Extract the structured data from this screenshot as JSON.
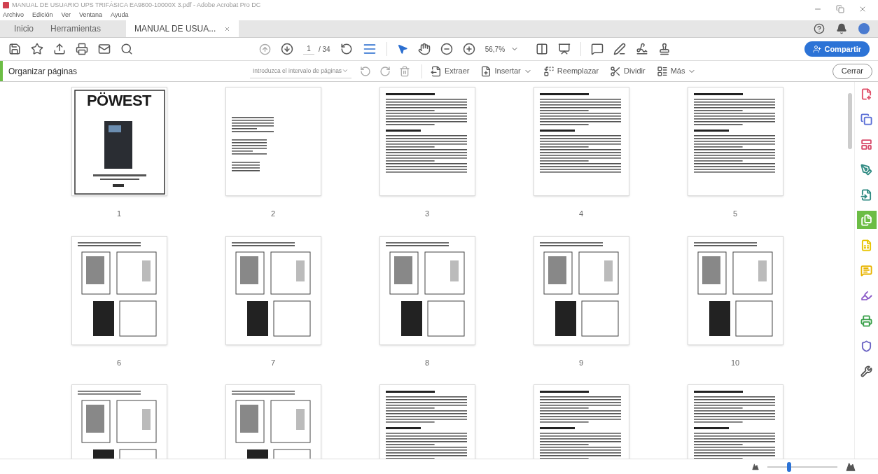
{
  "window": {
    "title": "MANUAL DE USUARIO UPS TRIFÁSICA EA9800-10000X 3.pdf - Adobe Acrobat Pro DC"
  },
  "menu": [
    "Archivo",
    "Edición",
    "Ver",
    "Ventana",
    "Ayuda"
  ],
  "tabs": [
    {
      "label": "Inicio",
      "selected": false,
      "closable": false
    },
    {
      "label": "Herramientas",
      "selected": false,
      "closable": false
    },
    {
      "label": "MANUAL DE USUA...",
      "selected": true,
      "closable": true
    }
  ],
  "toolbar": {
    "page_current": "1",
    "page_total": "/ 34",
    "zoom": "56,7%",
    "share_button": "Compartir"
  },
  "organize_bar": {
    "title": "Organizar páginas",
    "range_placeholder": "Introduzca el intervalo de páginas",
    "actions": [
      {
        "label": "Extraer",
        "dropdown": false
      },
      {
        "label": "Insertar",
        "dropdown": true
      },
      {
        "label": "Reemplazar",
        "dropdown": false
      },
      {
        "label": "Dividir",
        "dropdown": false
      },
      {
        "label": "Más",
        "dropdown": true
      }
    ],
    "close_button": "Cerrar"
  },
  "pages": [
    {
      "number": "1",
      "kind": "cover",
      "logo": "PÖWEST"
    },
    {
      "number": "2",
      "kind": "sparse"
    },
    {
      "number": "3",
      "kind": "text"
    },
    {
      "number": "4",
      "kind": "text"
    },
    {
      "number": "5",
      "kind": "text"
    },
    {
      "number": "6",
      "kind": "diagram"
    },
    {
      "number": "7",
      "kind": "diagram"
    },
    {
      "number": "8",
      "kind": "diagram"
    },
    {
      "number": "9",
      "kind": "diagram"
    },
    {
      "number": "10",
      "kind": "diagram"
    },
    {
      "kind": "diagram"
    },
    {
      "kind": "diagram"
    },
    {
      "kind": "text"
    },
    {
      "kind": "text"
    },
    {
      "kind": "text"
    }
  ],
  "tools": [
    {
      "color": "#e0506a",
      "selected": false
    },
    {
      "color": "#5b6fd6",
      "selected": false
    },
    {
      "color": "#d84a6a",
      "selected": false
    },
    {
      "color": "#2f8a82",
      "selected": false
    },
    {
      "color": "#2f8a82",
      "selected": false
    },
    {
      "color": "#6cbd45",
      "selected": true
    },
    {
      "color": "#e8c400",
      "selected": false
    },
    {
      "color": "#e8b400",
      "selected": false
    },
    {
      "color": "#8c5cc8",
      "selected": false
    },
    {
      "color": "#3aa04a",
      "selected": false
    },
    {
      "color": "#6b63c4",
      "selected": false
    },
    {
      "color": "#555555",
      "selected": false
    }
  ],
  "zoom_slider": {
    "level": 0.3
  }
}
